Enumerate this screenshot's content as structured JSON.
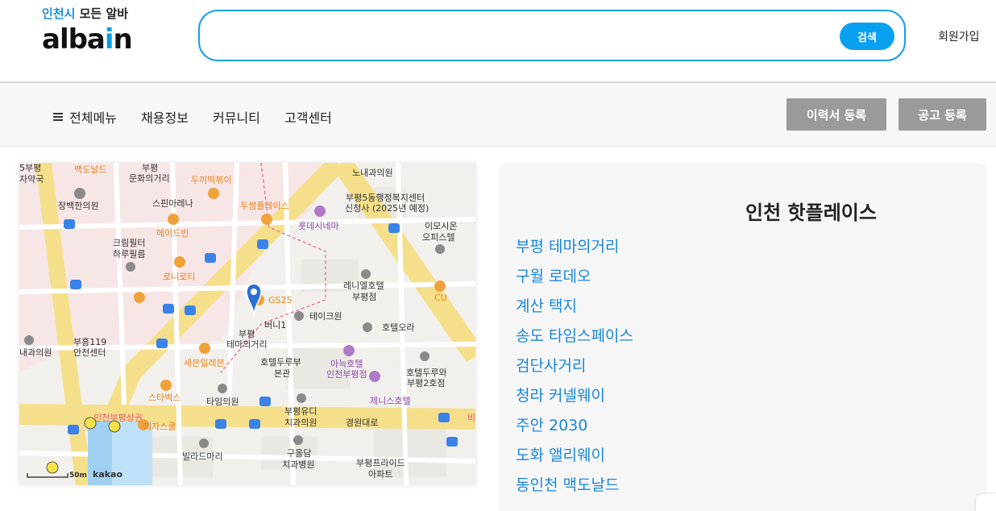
{
  "logo": {
    "tagline_highlight": "인천시",
    "tagline_rest": " 모든 알바",
    "wordmark_start": "alba",
    "wordmark_i": "i",
    "wordmark_end": "n"
  },
  "search": {
    "value": "",
    "placeholder": "",
    "button_label": "검색"
  },
  "header": {
    "signup_label": "회원가입"
  },
  "nav": {
    "menu_label": "전체메뉴",
    "items": [
      "채용정보",
      "커뮤니티",
      "고객센터"
    ],
    "resume_button": "이력서 등록",
    "post_button": "공고 등록"
  },
  "map": {
    "labels": [
      "5부평",
      "맥도날드",
      "부평",
      "문화의거리",
      "노내과의원",
      "자약국",
      "두끼떡볶이",
      "장백한의원",
      "스핀아레나",
      "부평5동행정복지센터",
      "신청사 (2025년 예정)",
      "두썸플레이스",
      "롯데시네마",
      "메이드빈",
      "이모시온",
      "오피스텔",
      "크림필터",
      "하루필름",
      "로니로티",
      "레니엘호텔",
      "부평점",
      "GS25",
      "CU",
      "테이크원",
      "버니1",
      "호텔오라",
      "부평",
      "테마의거리",
      "부흥119",
      "안전센터",
      "내과의원",
      "세븐일레븐",
      "호텔두루부",
      "본관",
      "아늑호텔",
      "인천부평점",
      "호텔두루와",
      "부평2호점",
      "스타벅스",
      "제니스호텔",
      "타임의원",
      "부평유디",
      "치과의원",
      "경원대로",
      "인천부평상권",
      "피자스쿨",
      "빌라드마리",
      "구올담",
      "치과병원",
      "부평프라이드",
      "아파트",
      "비",
      "50m",
      "kakao"
    ]
  },
  "hotplaces": {
    "title": "인천 핫플레이스",
    "items": [
      "부평 테마의거리",
      "구월 로데오",
      "계산 택지",
      "송도 타임스페이스",
      "검단사거리",
      "청라 커넬웨이",
      "주안 2030",
      "도화 앨리웨이",
      "동인천 맥도날드"
    ]
  },
  "colors": {
    "accent": "#14a0e8",
    "link": "#1a86d9",
    "nav_button": "#9a9a9a"
  }
}
